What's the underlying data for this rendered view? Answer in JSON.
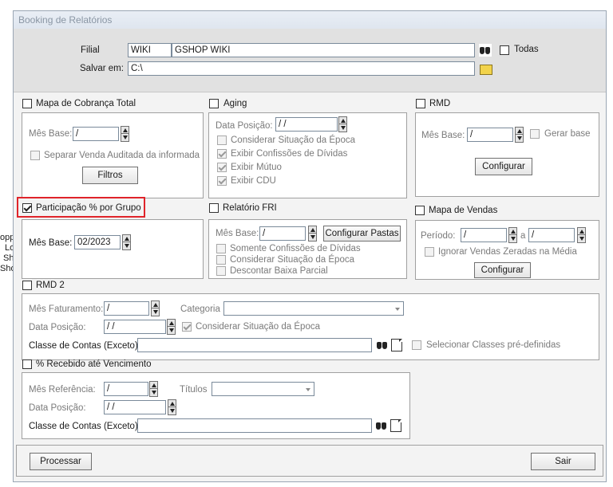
{
  "window": {
    "title": "Booking de Relatórios"
  },
  "background": {
    "fragments": [
      "opp",
      "Lo",
      "Sh",
      "Sho"
    ]
  },
  "header": {
    "filial_label": "Filial",
    "filial_code": "WIKI",
    "filial_name": "GSHOP WIKI",
    "todas_label": "Todas",
    "salvar_label": "Salvar em:",
    "salvar_value": "C:\\"
  },
  "mapa_cobranca": {
    "title": "Mapa de Cobrança Total",
    "mes_base_label": "Mês Base:",
    "mes_base_value": " /",
    "separar_label": "Separar Venda Auditada da informada",
    "filtros_label": "Filtros"
  },
  "aging": {
    "title": "Aging",
    "data_posicao_label": "Data Posição:",
    "data_posicao_value": " / /",
    "opt1": "Considerar Situação da Época",
    "opt2": "Exibir Confissões de Dívidas",
    "opt3": "Exibir Mútuo",
    "opt4": "Exibir CDU"
  },
  "rmd": {
    "title": "RMD",
    "mes_base_label": "Mês Base:",
    "mes_base_value": " /",
    "gerar_label": "Gerar base",
    "configurar_label": "Configurar"
  },
  "participacao": {
    "title": "Participação % por Grupo",
    "mes_base_label": "Mês Base:",
    "mes_base_value": "02/2023"
  },
  "fri": {
    "title": "Relatório FRI",
    "mes_base_label": "Mês Base:",
    "mes_base_value": " /",
    "configurar_pastas_label": "Configurar Pastas",
    "opt1": "Somente Confissões de Dívidas",
    "opt2": "Considerar Situação da Época",
    "opt3": "Descontar Baixa Parcial"
  },
  "mapa_vendas": {
    "title": "Mapa de Vendas",
    "periodo_label": "Período:",
    "periodo_from": " /",
    "a_label": "a",
    "periodo_to": " /",
    "ignorar_label": "Ignorar Vendas Zeradas na Média",
    "configurar_label": "Configurar"
  },
  "rmd2": {
    "title": "RMD 2",
    "mes_fat_label": "Mês Faturamento:",
    "mes_fat_value": " /",
    "categoria_label": "Categoria",
    "data_posicao_label": "Data Posição:",
    "data_posicao_value": " / /",
    "considerar_label": "Considerar Situação da Época",
    "classe_label": "Classe de Contas (Exceto)",
    "selecionar_label": "Selecionar Classes pré-definidas"
  },
  "recebido": {
    "title": "% Recebido até Vencimento",
    "mes_ref_label": "Mês Referência:",
    "mes_ref_value": " /",
    "titulos_label": "Títulos",
    "data_posicao_label": "Data Posição:",
    "data_posicao_value": " / /",
    "classe_label": "Classe de Contas (Exceto)"
  },
  "footer": {
    "processar_label": "Processar",
    "sair_label": "Sair"
  },
  "colors": {
    "highlight": "#e0242a",
    "title_bar": "#dfe6ef",
    "header_bg": "#e1e1e1"
  }
}
